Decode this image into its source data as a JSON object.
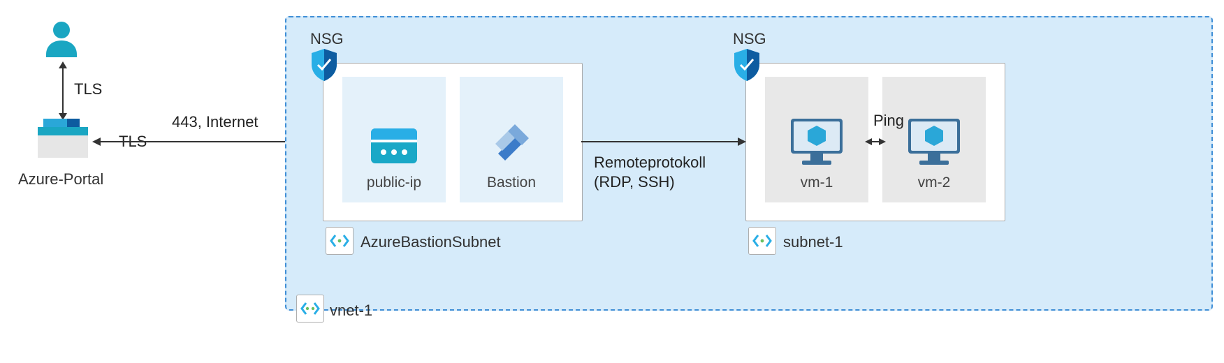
{
  "user_to_portal": {
    "label": "TLS"
  },
  "portal": {
    "label": "Azure-Portal"
  },
  "portal_to_vnet": {
    "left_label": "TLS",
    "right_label": "443, Internet"
  },
  "vnet": {
    "label": "vnet-1"
  },
  "subnets": {
    "bastion": {
      "nsg_label": "NSG",
      "name": "AzureBastionSubnet",
      "cards": {
        "publicip": "public-ip",
        "bastion": "Bastion"
      }
    },
    "vm": {
      "nsg_label": "NSG",
      "name": "subnet-1",
      "cards": {
        "vm1": "vm-1",
        "vm2": "vm-2"
      }
    }
  },
  "bastion_to_vm": {
    "line1": "Remoteprotokoll",
    "line2": "(RDP, SSH)"
  },
  "vm1_to_vm2": {
    "label": "Ping"
  },
  "icons": {
    "user": "#1aa6c2",
    "shield_dark": "#0d5ca0",
    "shield_light": "#29aee6",
    "vm_screen": "#dceaf5",
    "vm_cube": "#2aa7d8",
    "bastion": "#3c7cc9",
    "publicip_top": "#29aee6",
    "publicip_body": "#1aa8c7",
    "portal_base": "#2aa7d8"
  }
}
